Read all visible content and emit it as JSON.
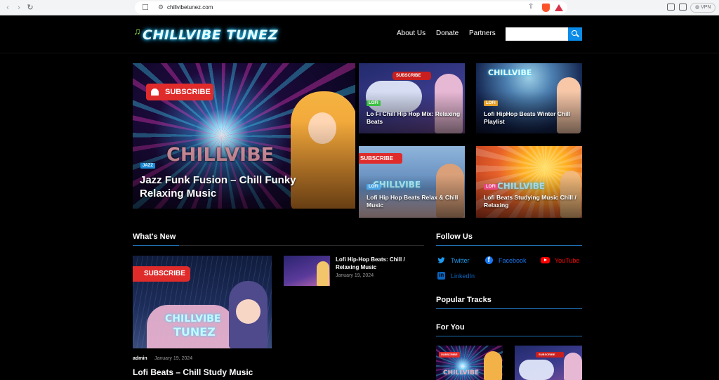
{
  "browser": {
    "url": "chillvibetunez.com",
    "vpn_label": "VPN",
    "back": "‹",
    "forward": "›",
    "reload": "↻",
    "bookmark": "☐",
    "share": "⇧"
  },
  "site": {
    "logo_note": "♫",
    "logo_text": "CHILLVIBE TUNEZ",
    "nav": [
      "About Us",
      "Donate",
      "Partners"
    ],
    "search_placeholder": ""
  },
  "featured": [
    {
      "category": "JAZZ",
      "title": "Jazz Funk Fusion – Chill Funky Relaxing Music"
    },
    {
      "category": "LOFI",
      "title": "Lo Fi Chill Hip Hop Mix: Relaxing Beats"
    },
    {
      "category": "LOFI",
      "title": "Lofi HipHop Beats Winter Chill Playlist"
    },
    {
      "category": "LOFI",
      "title": "Lofi Hip Hop Beats Relax & Chill Music"
    },
    {
      "category": "LOFI",
      "title": "Lofi Beats Studying Music Chill / Relaxing"
    }
  ],
  "image_text": {
    "subscribe": "SUBSCRIBE",
    "chillvibe": "CHILLVIBE",
    "tunez": "TUNEZ"
  },
  "whats_new": {
    "heading": "What's New",
    "main": {
      "author": "admin",
      "date": "January 19, 2024",
      "title": "Lofi Beats – Chill Study Music"
    },
    "side": {
      "title": "Lofi Hip-Hop Beats: Chill / Relaxing Music",
      "date": "January 19, 2024"
    }
  },
  "follow": {
    "heading": "Follow Us",
    "links": [
      {
        "label": "Twitter",
        "color": "#1d9bf0"
      },
      {
        "label": "Facebook",
        "color": "#1877f2"
      },
      {
        "label": "YouTube",
        "color": "#ff0000"
      },
      {
        "label": "LinkedIn",
        "color": "#0a66c2"
      }
    ]
  },
  "popular": {
    "heading": "Popular Tracks"
  },
  "foryou": {
    "heading": "For You"
  },
  "colors": {
    "accent": "#0a8ce8",
    "background": "#000000"
  }
}
